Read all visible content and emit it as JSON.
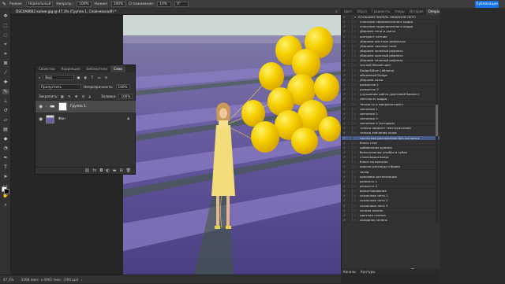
{
  "options_bar": {
    "mode_label": "Режим:",
    "mode_value": "Нормальный",
    "opacity_label": "Непрозр.:",
    "opacity_value": "100%",
    "pressure_label": "Нажим:",
    "pressure_value": "100%",
    "smoothing_label": "Сглаживание:",
    "smoothing_value": "10%",
    "angle_value": "0°",
    "share_button": "Публикация"
  },
  "document_tab": {
    "title": "DSC0A0662 копия.jpg @ 47,3% (Группа 1, Слой-маска/8) *",
    "close": "×"
  },
  "status_bar": {
    "zoom": "47,3%",
    "size": "3268 пикс. x 4902 пикс. (300 ppi)"
  },
  "layers_panel": {
    "tabs": [
      "Свойства",
      "Коррекция",
      "Библиотеки",
      "Слои"
    ],
    "active_tab": "Слои",
    "filter_label": "Вид",
    "blend_mode": "Пропустить",
    "opacity_label": "Непрозрачность:",
    "opacity_value": "100%",
    "lock_label": "Закрепить:",
    "fill_label": "Заливка:",
    "fill_value": "100%",
    "layers": [
      {
        "name": "Группа 1"
      },
      {
        "name": "Фон"
      }
    ],
    "colors": {
      "panel": "#323232",
      "selected": "#4b4b4b"
    }
  },
  "right_panel": {
    "tabs": [
      "Цвет",
      "Образ",
      "Градиенты",
      "Узоры",
      "История",
      "Операции",
      "Библио"
    ],
    "active_tab": "Операции",
    "group_title": "БОЛЬШАЯ ПАНЕЛЬ ЭКШЕНОВ ЛЕТО",
    "actions": [
      "спасение пересвеченного кадра",
      "спасение недосвеченного кадра",
      "убираем тени и света",
      "контраст летние",
      "убираем жесткие рефлексы",
      "убираем грязные тона",
      "убираем зеленый рефлекс",
      "убираем красный рефлекс",
      "убираем зеленый рефлекс",
      "чистый белый цвет",
      "Dodge&Burn (облако)",
      "объемный Dodge",
      "убираем кожи",
      "размытие 1",
      "размытие 2",
      "улучшение цвета (цветовой баланс)",
      "светлость кадра",
      "Четкость и микроконтраст",
      "свечение 1",
      "свечение 2",
      "свечение 3",
      "свечение 4 (которые)",
      "только прирост текстуры кожи",
      "только значения кожи",
      "частотное разложение без пэтчинга",
      "блеск глаз",
      "добавление румяна",
      "белоснежная улыбка в зубах",
      "стилизация волос",
      "блеск на волосах",
      "красим ресницы и брови",
      "загар",
      "красивая детализация",
      "резкость 1",
      "резкость 2",
      "виньетирование",
      "сказочное лето 1",
      "сказочное лето 2",
      "сказочное лето 3",
      "сочная зелень",
      "цветная пленка",
      "холодная зелень"
    ],
    "selected_index": 24,
    "bottom_tabs": [
      "Каналы",
      "Контуры"
    ],
    "colors": {
      "selected": "#47598a"
    }
  },
  "colors": {
    "accent": "#1473e6",
    "balloon": "#f6d000",
    "lavender": "#6b5fa2"
  }
}
